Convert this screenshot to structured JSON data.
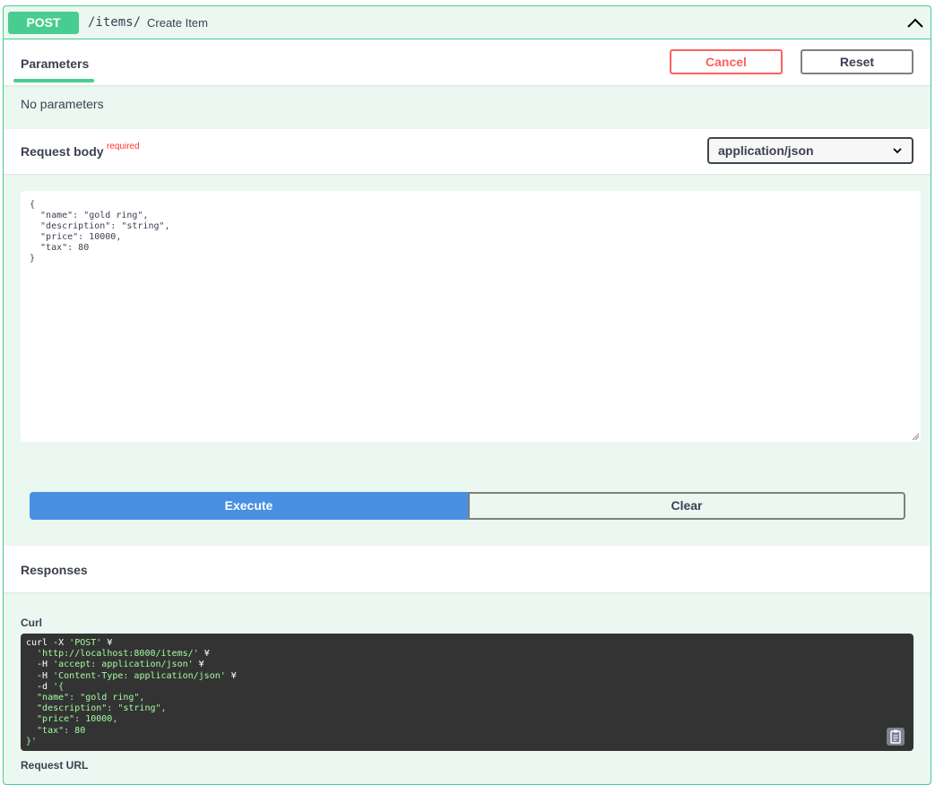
{
  "operation": {
    "method": "POST",
    "path": "/items/",
    "summary": "Create Item"
  },
  "parameters": {
    "tab_label": "Parameters",
    "cancel_label": "Cancel",
    "reset_label": "Reset",
    "empty_text": "No parameters"
  },
  "request_body": {
    "title": "Request body",
    "required_label": "required",
    "content_type": "application/json",
    "content_type_options": [
      "application/json"
    ],
    "value": "{\n  \"name\": \"gold ring\",\n  \"description\": \"string\",\n  \"price\": 10000,\n  \"tax\": 80\n}"
  },
  "actions": {
    "execute_label": "Execute",
    "clear_label": "Clear"
  },
  "responses": {
    "title": "Responses",
    "curl_label": "Curl",
    "curl_lines": [
      {
        "pre": "curl -X ",
        "str": "'POST'",
        "post": " ¥"
      },
      {
        "pre": "  ",
        "str": "'http://localhost:8000/items/'",
        "post": " ¥"
      },
      {
        "pre": "  -H ",
        "str": "'accept: application/json'",
        "post": " ¥"
      },
      {
        "pre": "  -H ",
        "str": "'Content-Type: application/json'",
        "post": " ¥"
      },
      {
        "pre": "  -d ",
        "str": "'{",
        "post": ""
      },
      {
        "pre": "",
        "str": "  \"name\": \"gold ring\",",
        "post": ""
      },
      {
        "pre": "",
        "str": "  \"description\": \"string\",",
        "post": ""
      },
      {
        "pre": "",
        "str": "  \"price\": 10000,",
        "post": ""
      },
      {
        "pre": "",
        "str": "  \"tax\": 80",
        "post": ""
      },
      {
        "pre": "",
        "str": "}'",
        "post": ""
      }
    ],
    "request_url_label": "Request URL"
  },
  "colors": {
    "post_green": "#49cc90",
    "block_bg": "#ebf7f1",
    "execute_blue": "#4990e2",
    "cancel_red": "#ff6060",
    "code_bg": "#333333",
    "code_string": "#a2fca2"
  },
  "icons": {
    "collapse": "chevron-up-icon",
    "select": "chevron-down-icon",
    "copy": "clipboard-icon",
    "resize": "resize-grip-icon"
  }
}
